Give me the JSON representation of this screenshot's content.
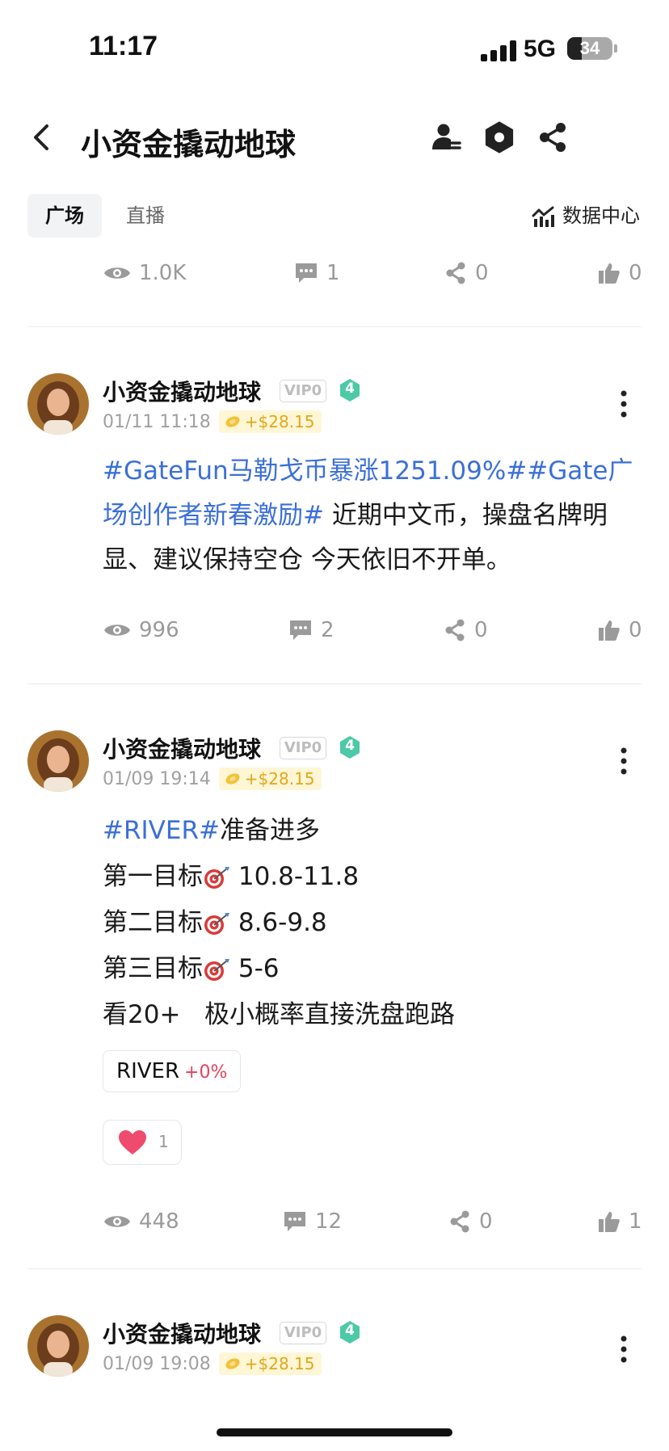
{
  "status_bar": {
    "time": "11:17",
    "network": "5G",
    "battery": "34"
  },
  "header": {
    "title": "小资金撬动地球"
  },
  "tabs": [
    {
      "label": "广场"
    },
    {
      "label": "直播"
    }
  ],
  "data_center": {
    "label": "数据中心"
  },
  "top_stats": {
    "views": "1.0K",
    "comments": "1",
    "shares": "0",
    "likes": "0"
  },
  "posts": [
    {
      "author": "小资金撬动地球",
      "vip": "VIP0",
      "level": "4",
      "time": "01/11 11:18",
      "reward": "+$28.15",
      "content_tag1": "#GateFun马勒戈币暴涨1251.09%#",
      "content_tag2": "#Gate广场创作者新春激励#",
      "content_text": " 近期中文币，操盘名牌明显、建议保持空仓 今天依旧不开单。",
      "stats": {
        "views": "996",
        "comments": "2",
        "shares": "0",
        "likes": "0"
      }
    },
    {
      "author": "小资金撬动地球",
      "vip": "VIP0",
      "level": "4",
      "time": "01/09 19:14",
      "reward": "+$28.15",
      "content_tag": "#RIVER#",
      "content_first": "准备进多",
      "targets": [
        {
          "label": "第一目标",
          "value": " 10.8-11.8"
        },
        {
          "label": "第二目标",
          "value": " 8.6-9.8"
        },
        {
          "label": "第三目标",
          "value": " 5-6"
        }
      ],
      "content_last": "看20+   极小概率直接洗盘跑路",
      "token": {
        "symbol": "RIVER",
        "change": "+0%"
      },
      "reaction_count": "1",
      "stats": {
        "views": "448",
        "comments": "12",
        "shares": "0",
        "likes": "1"
      }
    },
    {
      "author": "小资金撬动地球",
      "vip": "VIP0",
      "level": "4",
      "time": "01/09 19:08",
      "reward": "+$28.15"
    }
  ],
  "colors": {
    "link": "#3b6fd8",
    "level_badge": "#4cc9a6",
    "reward_bg": "#fff6d6",
    "reward_text": "#e0a81a",
    "negative": "#e0435f"
  },
  "icons": [
    "back-icon",
    "user-icon",
    "gear-icon",
    "share-icon",
    "chart-icon",
    "eye-icon",
    "comment-icon",
    "like-icon",
    "more-icon",
    "target-icon",
    "heart-icon",
    "coin-icon"
  ]
}
